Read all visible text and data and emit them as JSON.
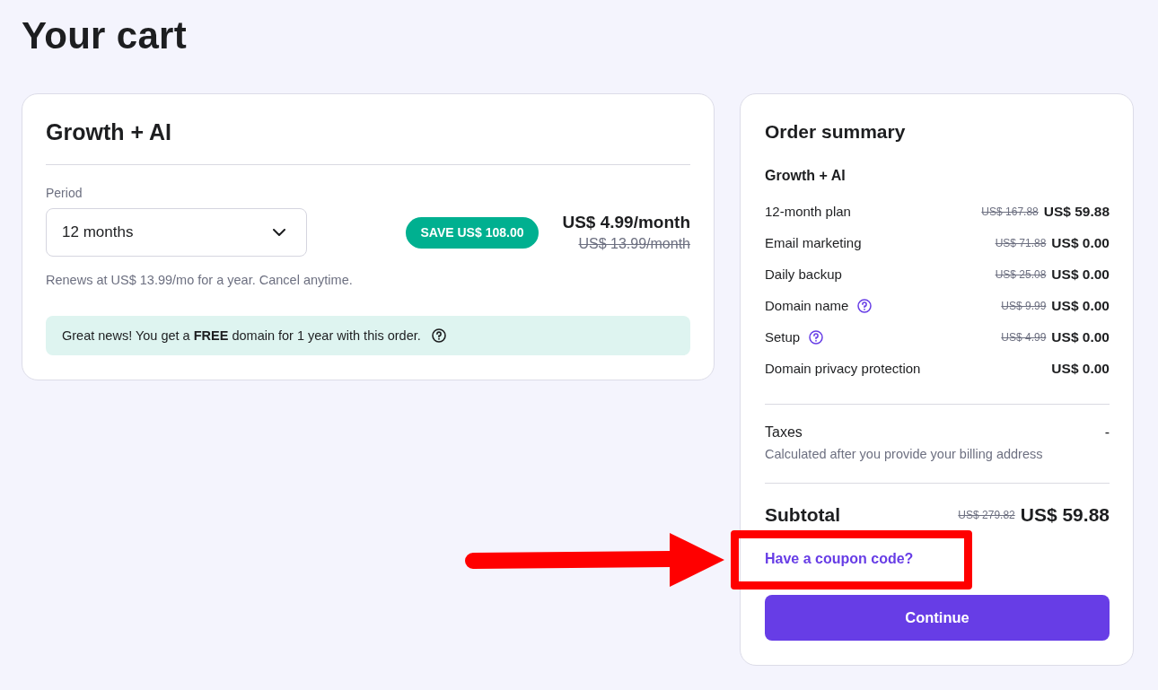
{
  "page_title": "Your cart",
  "plan_card": {
    "title": "Growth + AI",
    "period": {
      "label": "Period",
      "value": "12 months"
    },
    "save_badge": "SAVE US$ 108.00",
    "price": "US$ 4.99/month",
    "old_price": "US$ 13.99/month",
    "renewal_note": "Renews at US$ 13.99/mo for a year. Cancel anytime.",
    "notice": "Great news! You get a **FREE** domain for 1 year with this order."
  },
  "order_summary": {
    "title": "Order summary",
    "plan": "Growth + AI",
    "items": [
      {
        "label": "12-month plan",
        "help": false,
        "old_price": "US$ 167.88",
        "price": "US$ 59.88"
      },
      {
        "label": "Email marketing",
        "help": false,
        "old_price": "US$ 71.88",
        "price": "US$ 0.00"
      },
      {
        "label": "Daily backup",
        "help": false,
        "old_price": "US$ 25.08",
        "price": "US$ 0.00"
      },
      {
        "label": "Domain name",
        "help": true,
        "old_price": "US$ 9.99",
        "price": "US$ 0.00"
      },
      {
        "label": "Setup",
        "help": true,
        "old_price": "US$ 4.99",
        "price": "US$ 0.00"
      },
      {
        "label": "Domain privacy protection",
        "help": false,
        "price": "US$ 0.00"
      }
    ],
    "taxes": {
      "label": "Taxes",
      "value": "-",
      "note": "Calculated after you provide your billing address"
    },
    "subtotal": {
      "label": "Subtotal",
      "old_price": "US$ 279.82",
      "price": "US$ 59.88"
    },
    "coupon_link": "Have a coupon code?",
    "continue_button": "Continue"
  },
  "callout": {
    "kind": "arrow_and_frame"
  }
}
